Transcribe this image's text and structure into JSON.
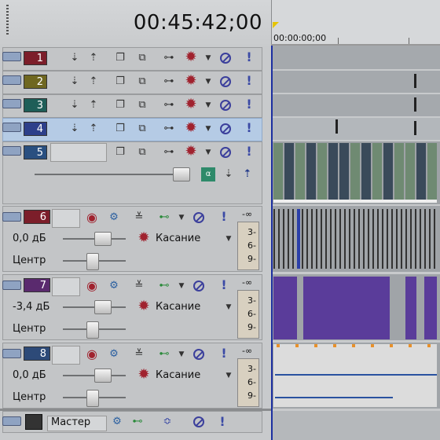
{
  "header": {
    "timecode": "00:45:42;00",
    "ruler_time": "00:00:00;00"
  },
  "video_tracks": [
    {
      "number": "1",
      "color": "#7c1e2a",
      "selected": false
    },
    {
      "number": "2",
      "color": "#6f6720",
      "selected": false
    },
    {
      "number": "3",
      "color": "#1e5e58",
      "selected": false
    },
    {
      "number": "4",
      "color": "#2d3f8a",
      "selected": true
    },
    {
      "number": "5",
      "color": "#294f80",
      "selected": false
    }
  ],
  "audio_tracks": [
    {
      "number": "6",
      "color": "#7c1e2a",
      "volume": "0,0 дБ",
      "pan": "Центр",
      "mode": "Касание",
      "meter_top": "-∞",
      "meter_scale": [
        "3-",
        "6-",
        "9-"
      ]
    },
    {
      "number": "7",
      "color": "#5a2a6e",
      "volume": "-3,4 дБ",
      "pan": "Центр",
      "mode": "Касание",
      "meter_top": "-∞",
      "meter_scale": [
        "3-",
        "6-",
        "9-"
      ]
    },
    {
      "number": "8",
      "color": "#2d4a78",
      "volume": "0,0 дБ",
      "pan": "Центр",
      "mode": "Касание",
      "meter_top": "-∞",
      "meter_scale": [
        "3-",
        "6-",
        "9-"
      ]
    }
  ],
  "master": {
    "label": "Мастер"
  },
  "icons": {
    "gear": "gear-icon",
    "prohibit": "bypass-icon",
    "exclamation": "exclamation-icon"
  }
}
